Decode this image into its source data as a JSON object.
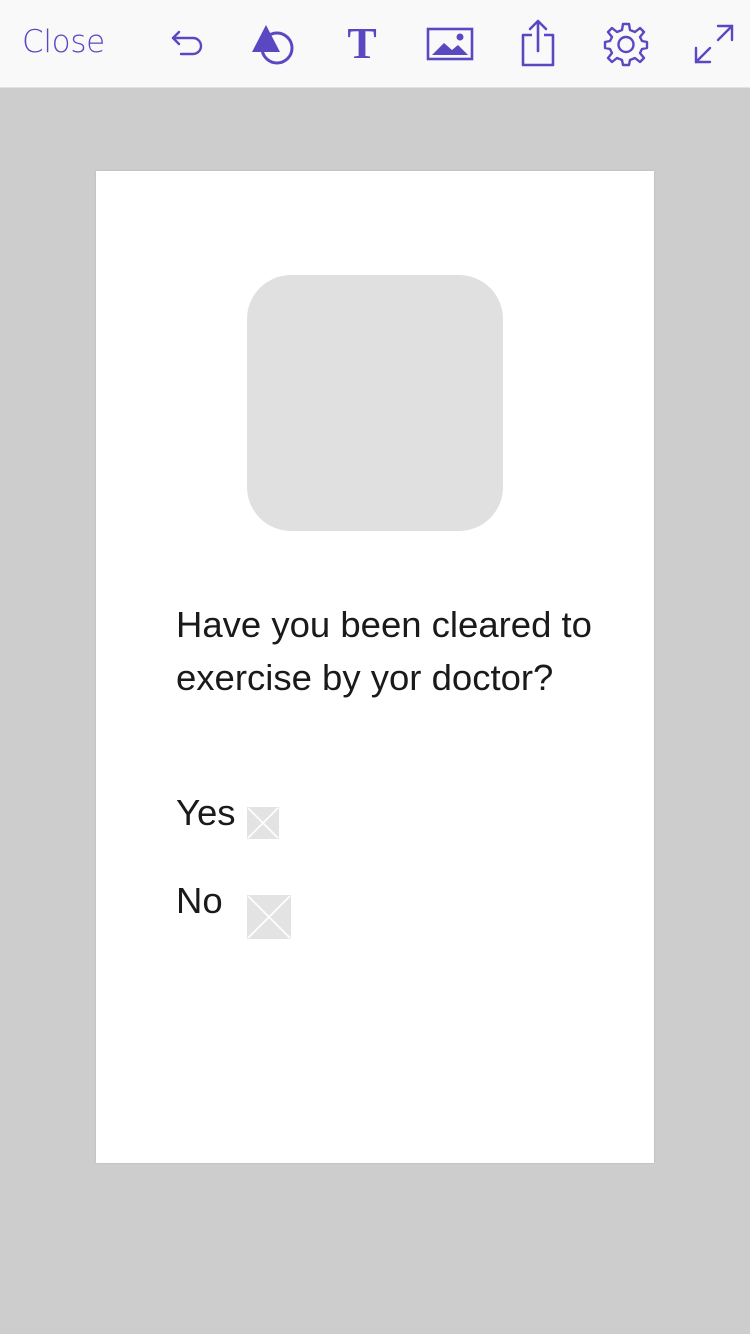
{
  "toolbar": {
    "close_label": "Close",
    "tools": [
      {
        "icon": "undo-icon"
      },
      {
        "icon": "shapes-icon"
      },
      {
        "icon": "text-tool-icon",
        "glyph": "T"
      },
      {
        "icon": "image-icon"
      },
      {
        "icon": "share-icon"
      },
      {
        "icon": "settings-gear-icon"
      },
      {
        "icon": "expand-icon"
      }
    ],
    "accent_color": "#5a48c2"
  },
  "canvas": {
    "image_placeholder": "image-placeholder",
    "question": "Have you been cleared to exercise by yor doctor?",
    "options": [
      {
        "label": "Yes"
      },
      {
        "label": "No"
      }
    ]
  },
  "colors": {
    "background": "#cdcdcd",
    "toolbar": "#f9f9fa",
    "canvas": "#ffffff",
    "placeholder": "#e0e0e0"
  }
}
